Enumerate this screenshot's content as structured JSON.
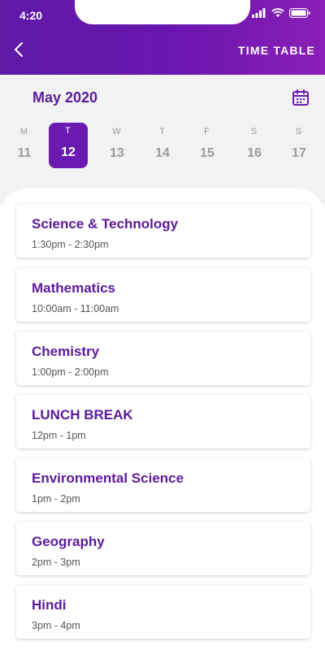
{
  "status_bar": {
    "time": "4:20"
  },
  "header": {
    "title": "TIME TABLE"
  },
  "calendar": {
    "month": "May 2020",
    "days": [
      {
        "name": "M",
        "date": "11",
        "active": false
      },
      {
        "name": "T",
        "date": "12",
        "active": true
      },
      {
        "name": "W",
        "date": "13",
        "active": false
      },
      {
        "name": "T",
        "date": "14",
        "active": false
      },
      {
        "name": "F",
        "date": "15",
        "active": false
      },
      {
        "name": "S",
        "date": "16",
        "active": false
      },
      {
        "name": "S",
        "date": "17",
        "active": false
      }
    ]
  },
  "schedule": [
    {
      "subject": "Science & Technology",
      "time": "1:30pm - 2:30pm"
    },
    {
      "subject": "Mathematics",
      "time": "10:00am - 11:00am"
    },
    {
      "subject": "Chemistry",
      "time": "1:00pm - 2:00pm"
    },
    {
      "subject": "LUNCH BREAK",
      "time": "12pm - 1pm"
    },
    {
      "subject": "Environmental Science",
      "time": "1pm - 2pm"
    },
    {
      "subject": "Geography",
      "time": "2pm - 3pm"
    },
    {
      "subject": "Hindi",
      "time": "3pm - 4pm"
    }
  ],
  "icons": {
    "back": "chevron-left-icon",
    "calendar": "calendar-icon",
    "signal": "signal-icon",
    "wifi": "wifi-icon",
    "battery": "battery-icon"
  },
  "colors": {
    "primary": "#6a1ab0",
    "accent_text": "#5b1a9c"
  }
}
